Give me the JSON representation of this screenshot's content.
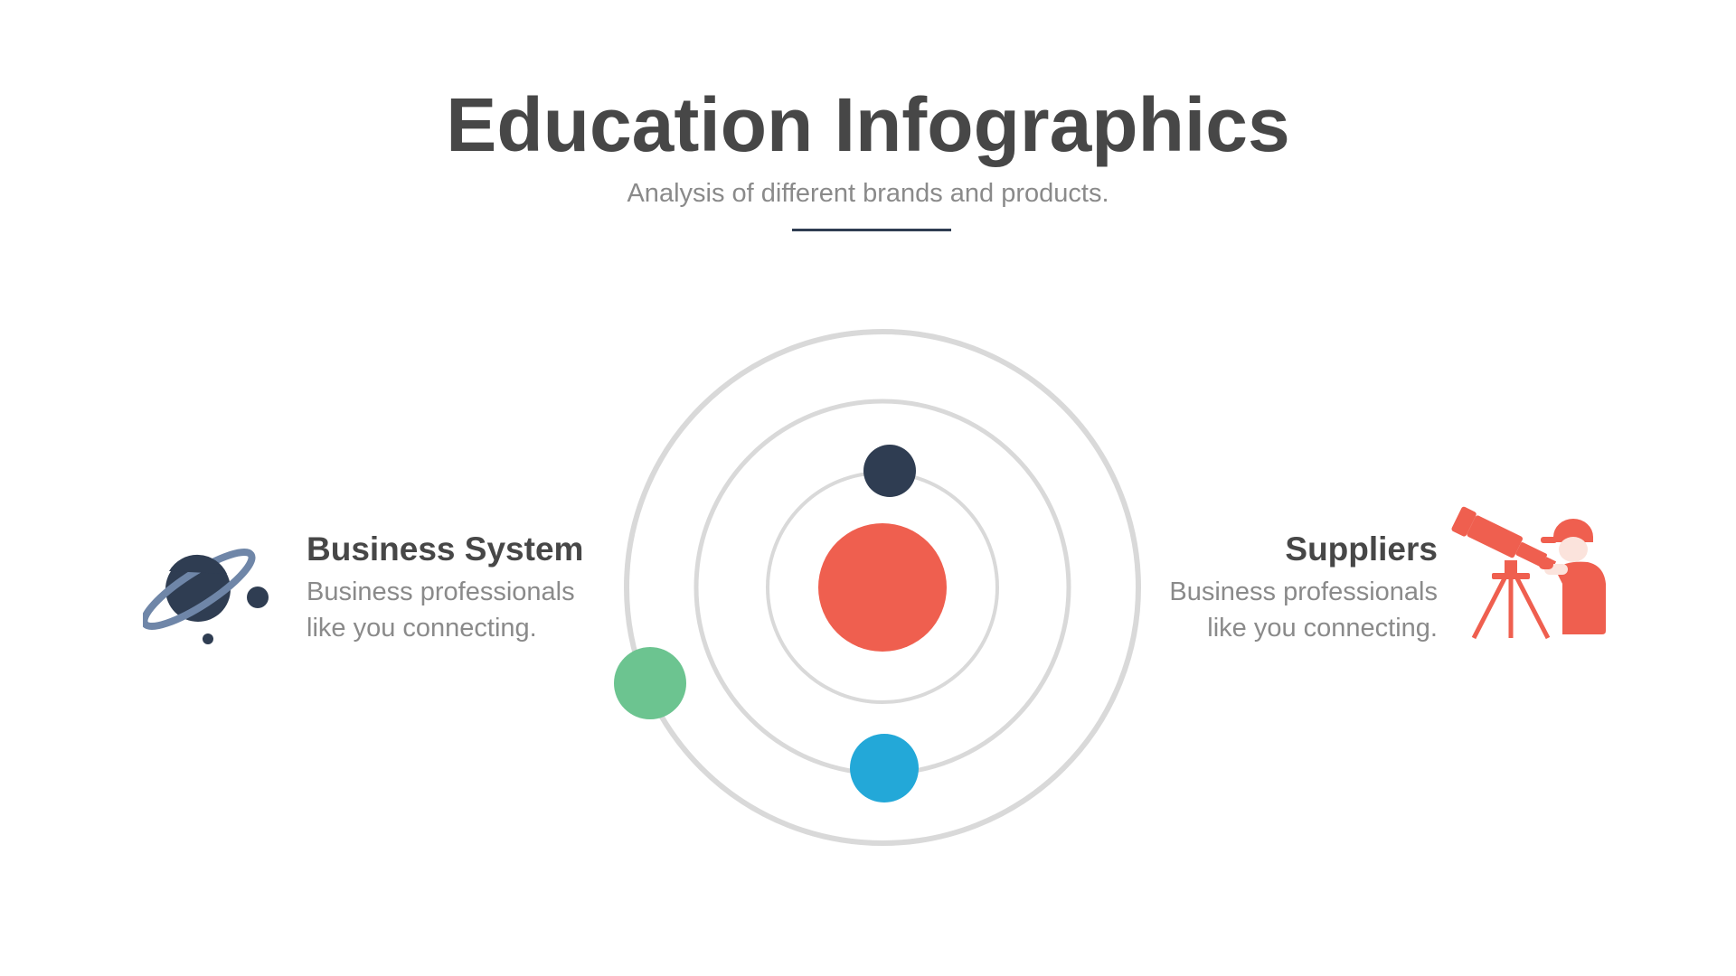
{
  "header": {
    "title": "Education Infographics",
    "subtitle": "Analysis of different brands and products."
  },
  "left_item": {
    "title": "Business System",
    "desc_line1": "Business professionals",
    "desc_line2": "like you connecting.",
    "icon": "planet-icon"
  },
  "right_item": {
    "title": "Suppliers",
    "desc_line1": "Business professionals",
    "desc_line2": "like you connecting.",
    "icon": "telescope-astronomer-icon"
  },
  "colors": {
    "title_text": "#474747",
    "body_text": "#8a8a8a",
    "divider": "#2f3d52",
    "orbit_ring": "#d9d9d9",
    "sun": "#ef5f4f",
    "planet_navy": "#2f3d52",
    "planet_green": "#6cc490",
    "planet_blue": "#23a8d8",
    "planet_ring": "#6f86a8"
  }
}
